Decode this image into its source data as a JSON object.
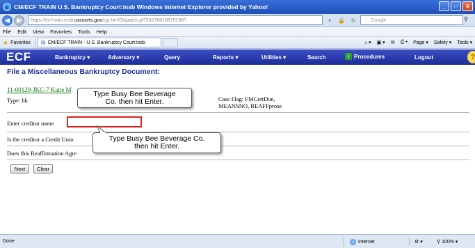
{
  "window": {
    "title": "CM/ECF TRAIN   U.S. Bankruptcy Court:insb   Windows Internet Explorer provided by Yahoo!",
    "controls": [
      "_",
      "□",
      "X"
    ]
  },
  "addressbar": {
    "back_glyph": "◀",
    "forward_glyph": "▶",
    "url_prefix": "https://ecf-train.insb.",
    "url_host": "uscourts.gov",
    "url_rest": "/cgi-bin/Dispatch.pl?20278815879196?",
    "search_placeholder": "Google"
  },
  "menubar": {
    "items": [
      "File",
      "Edit",
      "View",
      "Favorites",
      "Tools",
      "Help"
    ]
  },
  "favbar": {
    "favorites_label": "Favorites",
    "tab_label": "CM/ECF TRAIN - U.S. Bankruptcy Court:insb",
    "commands": [
      "Page ▾",
      "Safety ▾",
      "Tools ▾"
    ]
  },
  "ecf_nav": {
    "logo": "ECF",
    "menus": [
      "Bankruptcy ▾",
      "Adversary ▾",
      "Query",
      "Reports ▾",
      "Utilities ▾",
      "Search"
    ],
    "procedures": "Procedures",
    "logout": "Logout",
    "help_glyph": "?"
  },
  "page": {
    "title": "File a Miscellaneous Bankruptcy Document:",
    "case_link": "11-00129-JKC-7 Katie M",
    "case_type": "Type: bk",
    "case_flag_line1": "Case Flag: FMCertDue,",
    "case_flag_line2": "MEANSNO, REAFFprose",
    "creditor_label": "Enter creditor name",
    "credit_union_question": "Is the creditor a Credit Unio",
    "reaffirmation_question": "Does this Reaffirmation Agre",
    "next_button": "Next",
    "clear_button": "Clear"
  },
  "callouts": {
    "top_line1": "Type Busy Bee Beverage",
    "top_line2": "Co. then hit Enter.",
    "bottom_line1": "Type Busy Bee Beverage Co.",
    "bottom_line2": "then hit Enter."
  },
  "statusbar": {
    "left": "Done",
    "zone": "Internet",
    "zoom": "100%"
  },
  "colors": {
    "ecf_nav": "#1d2c98",
    "title_blue": "#1d2c98",
    "highlight_red": "#e02020",
    "link_green": "#0b7a0b"
  }
}
